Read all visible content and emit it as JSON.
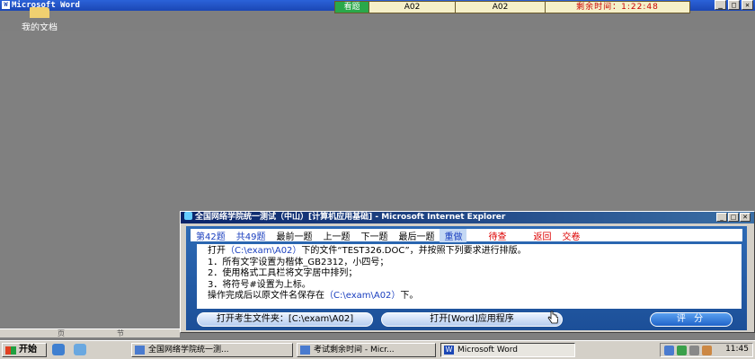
{
  "word": {
    "title": "Microsoft Word",
    "minimize": "_",
    "restore": "□",
    "close": "✕",
    "status_page": "页",
    "status_section": "节"
  },
  "desktop": {
    "folder_label": "我的文档"
  },
  "exam_bar": {
    "watch_label": "看题",
    "field1": "A02",
    "field2": "A02",
    "time_remaining": "剩余时间：1:22:48"
  },
  "ie": {
    "title": "全国网络学院统一测试（中山）[计算机应用基础] - Microsoft Internet Explorer",
    "nav": {
      "question_no": "第42题",
      "total": "共49题",
      "first": "最前一题",
      "prev": "上一题",
      "next": "下一题",
      "last": "最后一题",
      "redo": "重做",
      "pending": "待查",
      "back": "返回",
      "submit": "交卷"
    },
    "content": {
      "line1_prefix": "打开",
      "line1_path": "（C:\\exam\\A02）",
      "line1_suffix": "下的文件“TEST326.DOC”，并按照下列要求进行排版。",
      "line2": "1．所有文字设置为楷体_GB2312，小四号；",
      "line3": "2．使用格式工具栏将文字居中排列；",
      "line4": "3．将符号#设置为上标。",
      "line5_prefix": "操作完成后以原文件名保存在",
      "line5_path": "（C:\\exam\\A02）",
      "line5_suffix": "下。"
    },
    "buttons": {
      "open_folder": "打开考生文件夹：[C:\\exam\\A02]",
      "open_word": "打开[Word]应用程序",
      "score": "评 分"
    }
  },
  "taskbar": {
    "start": "开始",
    "tasks": [
      "全国网络学院统一测...",
      "考试剩余时间 - Micr...",
      "Microsoft Word"
    ],
    "word_icon_letter": "W",
    "clock": "11:45"
  },
  "colors": {
    "title_blue": "#1b47b5",
    "exam_green": "#2aa84a",
    "time_red": "#cc0000",
    "ie_panel": "#1c4f98"
  }
}
